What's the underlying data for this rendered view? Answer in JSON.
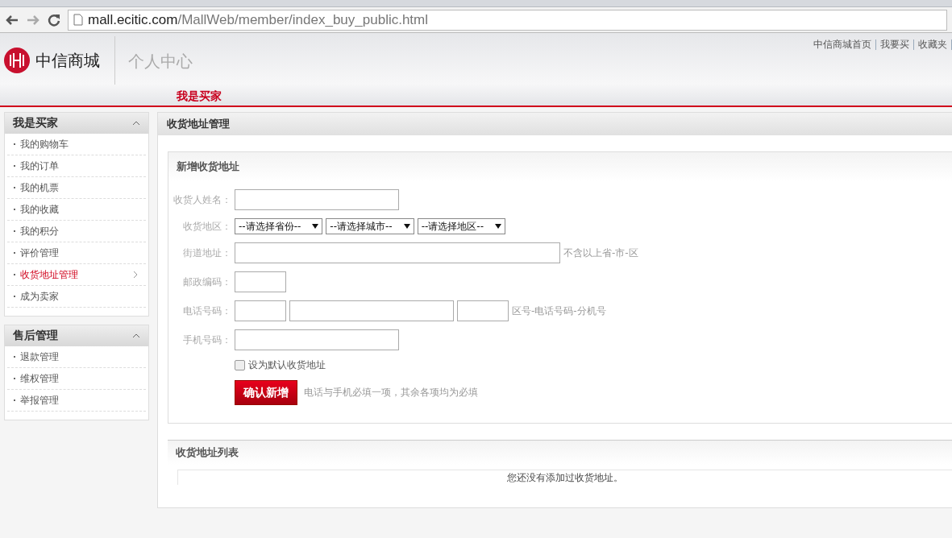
{
  "browser": {
    "url_host": "mall.ecitic.com",
    "url_path": "/MallWeb/member/index_buy_public.html"
  },
  "header": {
    "brand": "中信商城",
    "section_title": "个人中心",
    "top_links": [
      "中信商城首页",
      "我要买",
      "收藏夹"
    ],
    "nav": [
      {
        "label": "我是买家",
        "selected": true
      }
    ]
  },
  "sidebar": [
    {
      "title": "我是买家",
      "expanded": true,
      "items": [
        {
          "label": "我的购物车",
          "selected": false
        },
        {
          "label": "我的订单",
          "selected": false
        },
        {
          "label": "我的机票",
          "selected": false
        },
        {
          "label": "我的收藏",
          "selected": false
        },
        {
          "label": "我的积分",
          "selected": false
        },
        {
          "label": "评价管理",
          "selected": false
        },
        {
          "label": "收货地址管理",
          "selected": true
        },
        {
          "label": "成为卖家",
          "selected": false
        }
      ]
    },
    {
      "title": "售后管理",
      "expanded": true,
      "items": [
        {
          "label": "退款管理",
          "selected": false
        },
        {
          "label": "维权管理",
          "selected": false
        },
        {
          "label": "举报管理",
          "selected": false
        }
      ]
    }
  ],
  "main": {
    "title": "收货地址管理",
    "form": {
      "title": "新增收货地址",
      "fields": [
        {
          "kind": "text",
          "label": "收货人姓名："
        },
        {
          "kind": "selects",
          "label": "收货地区：",
          "options": [
            "--请选择省份--",
            "--请选择城市--",
            "--请选择地区--"
          ]
        },
        {
          "kind": "wide",
          "label": "街道地址：",
          "hint": "不含以上省-市-区"
        },
        {
          "kind": "short",
          "label": "邮政编码："
        },
        {
          "kind": "phone",
          "label": "电话号码：",
          "hint": "区号-电话号码-分机号"
        },
        {
          "kind": "text",
          "label": "手机号码："
        }
      ],
      "checkbox": {
        "label": "设为默认收货地址",
        "checked": false
      },
      "submit": "确认新增",
      "note": "电话与手机必填一项，其余各项均为必填"
    },
    "list": {
      "title": "收货地址列表",
      "empty_message": "您还没有添加过收货地址。"
    }
  }
}
